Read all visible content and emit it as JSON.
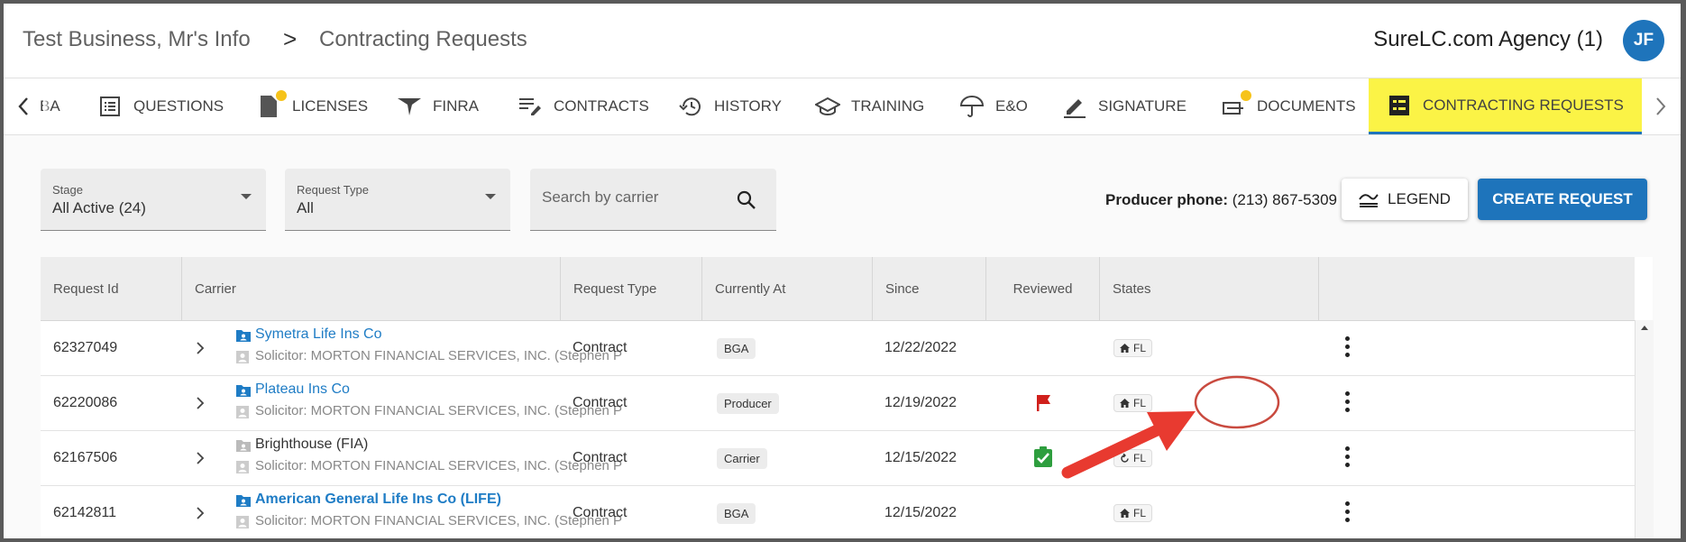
{
  "breadcrumb": {
    "root": "Test Business, Mr's Info",
    "separator": ">",
    "current": "Contracting Requests"
  },
  "agency": "SureLC.com Agency (1)",
  "avatar_initials": "JF",
  "tabs": [
    {
      "label": "BA",
      "icon": "building-icon"
    },
    {
      "label": "QUESTIONS",
      "icon": "list-icon"
    },
    {
      "label": "LICENSES",
      "icon": "document-icon",
      "notification": true
    },
    {
      "label": "FINRA",
      "icon": "finra-icon"
    },
    {
      "label": "CONTRACTS",
      "icon": "contract-edit-icon"
    },
    {
      "label": "HISTORY",
      "icon": "history-icon"
    },
    {
      "label": "TRAINING",
      "icon": "graduation-cap-icon"
    },
    {
      "label": "E&O",
      "icon": "umbrella-icon"
    },
    {
      "label": "SIGNATURE",
      "icon": "pen-icon"
    },
    {
      "label": "DOCUMENTS",
      "icon": "documents-icon",
      "notification": true
    },
    {
      "label": "CONTRACTING REQUESTS",
      "icon": "checklist-icon",
      "active": true
    }
  ],
  "filters": {
    "stage": {
      "label": "Stage",
      "value": "All Active (24)"
    },
    "request_type": {
      "label": "Request Type",
      "value": "All"
    },
    "search": {
      "placeholder": "Search by carrier"
    }
  },
  "producer_phone": {
    "label": "Producer phone:",
    "value": "(213) 867-5309"
  },
  "buttons": {
    "legend": "LEGEND",
    "create": "CREATE REQUEST"
  },
  "table": {
    "headers": [
      "Request Id",
      "Carrier",
      "Request Type",
      "Currently At",
      "Since",
      "Reviewed",
      "States"
    ],
    "rows": [
      {
        "id": "62327049",
        "carrier": "Symetra Life Ins Co",
        "carrier_linked": true,
        "solicitor": "Solicitor: MORTON FINANCIAL SERVICES, INC. (Stephen P",
        "type": "Contract",
        "at": "BGA",
        "since": "12/22/2022",
        "reviewed": "",
        "state": "FL",
        "state_icon": "home-icon"
      },
      {
        "id": "62220086",
        "carrier": "Plateau Ins Co",
        "carrier_linked": true,
        "solicitor": "Solicitor: MORTON FINANCIAL SERVICES, INC. (Stephen P",
        "type": "Contract",
        "at": "Producer",
        "since": "12/19/2022",
        "reviewed": "flag",
        "state": "FL",
        "state_icon": "home-icon"
      },
      {
        "id": "62167506",
        "carrier": "Brighthouse (FIA)",
        "carrier_linked": false,
        "solicitor": "Solicitor: MORTON FINANCIAL SERVICES, INC. (Stephen P",
        "type": "Contract",
        "at": "Carrier",
        "since": "12/15/2022",
        "reviewed": "check",
        "state": "FL",
        "state_icon": "refresh-icon"
      },
      {
        "id": "62142811",
        "carrier": "American General Life Ins Co (LIFE)",
        "carrier_linked": true,
        "solicitor": "Solicitor: MORTON FINANCIAL SERVICES, INC. (Stephen P",
        "type": "Contract",
        "at": "BGA",
        "since": "12/15/2022",
        "reviewed": "",
        "state": "FL",
        "state_icon": "home-icon"
      }
    ]
  },
  "colors": {
    "accent": "#1e74bb",
    "active_tab": "#fbf346",
    "flag": "#d0201c",
    "check": "#2e9e3e",
    "annotation_arrow": "#e83a30",
    "annotation_circle": "#c94a3f"
  }
}
